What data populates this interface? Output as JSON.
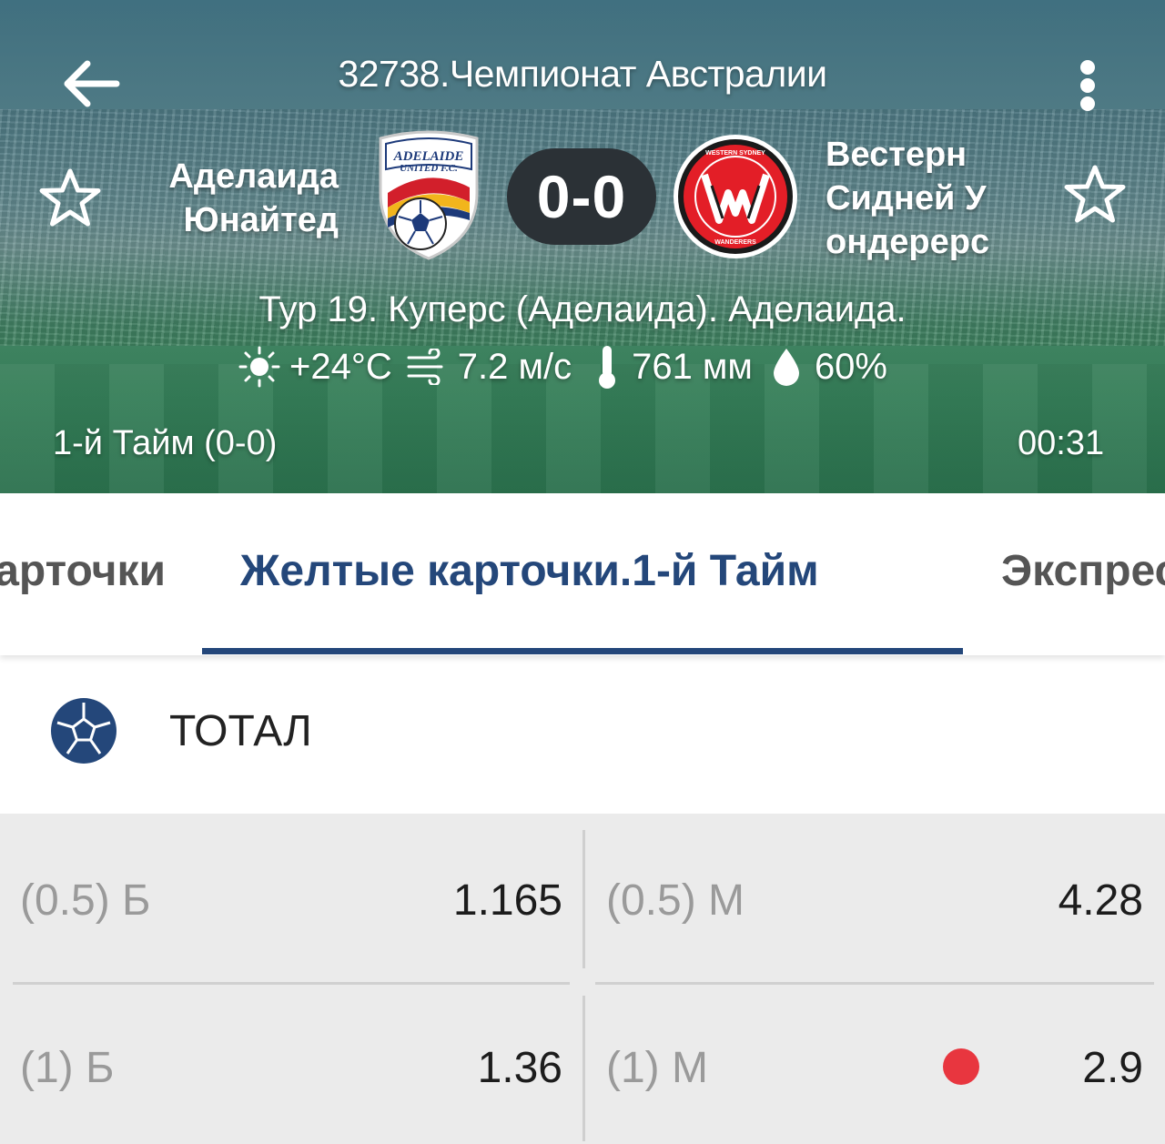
{
  "header": {
    "title": "32738.Чемпионат Австралии",
    "back_icon": "arrow-left-icon",
    "more_icon": "more-vert-icon",
    "team1": {
      "name": "Аделаида Юнайтед",
      "logo_text": "ADELAIDE UNITED F.C."
    },
    "team2": {
      "name": "Вестерн Сидней У ондерерс",
      "logo_text": "WESTERN SYDNEY WANDERERS"
    },
    "score": "0-0",
    "venue": "Тур 19. Куперс (Аделаида). Аделаида.",
    "weather": {
      "temperature": "+24°C",
      "wind": "7.2 м/с",
      "pressure": "761 мм",
      "humidity": "60%"
    },
    "period": "1-й  Тайм (0-0)",
    "clock": "00:31"
  },
  "tabs": {
    "prev": "Карточки",
    "active": "Желтые карточки.1-й  Тайм",
    "next": "Экспресс"
  },
  "section": {
    "title": "ТОТАЛ",
    "icon": "soccer-ball-icon"
  },
  "odds": [
    {
      "label": "(0.5) Б",
      "value": "1.165"
    },
    {
      "label": "(0.5) М",
      "value": "4.28"
    },
    {
      "label": "(1) Б",
      "value": "1.36"
    },
    {
      "label": "(1) М",
      "value": "2.9"
    }
  ],
  "colors": {
    "accent": "#24477a",
    "score_bg": "#2b3136",
    "odds_bg": "#ebebeb",
    "indicator_dot": "#e8363f",
    "team2_red": "#e31e27"
  }
}
